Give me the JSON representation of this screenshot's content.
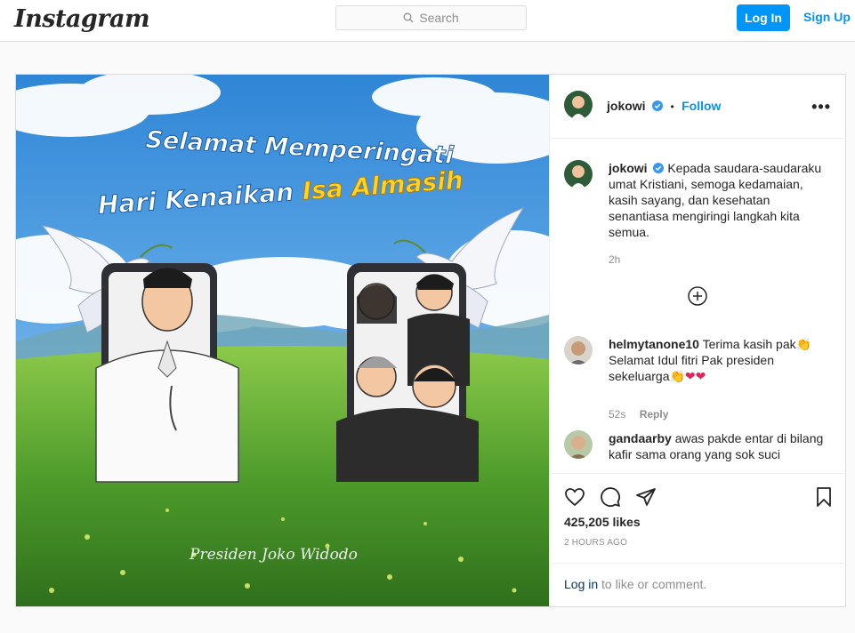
{
  "header": {
    "logo": "Instagram",
    "search_placeholder": "Search",
    "login_label": "Log In",
    "signup_label": "Sign Up"
  },
  "post": {
    "image": {
      "headline_line1": "Selamat Memperingati",
      "headline_line2_a": "Hari Kenaikan ",
      "headline_line2_b": "Isa Almasih",
      "signature": "Presiden Joko Widodo"
    },
    "author": {
      "username": "jokowi",
      "follow_label": "Follow",
      "dot": "•"
    },
    "more_icon": "•••",
    "caption": {
      "username": "jokowi",
      "text": "Kepada saudara-saudaraku umat Kristiani, semoga kedamaian, kasih sayang, dan kesehatan senantiasa mengiringi langkah kita semua.",
      "time": "2h"
    },
    "comments": [
      {
        "username": "helmytanone10",
        "text": "Terima kasih pak👏 Selamat Idul fitri Pak presiden sekeluarga👏",
        "hearts": "❤❤",
        "time": "52s",
        "reply_label": "Reply"
      },
      {
        "username": "gandaarby",
        "text": "awas pakde entar di bilang kafir sama orang yang sok suci"
      }
    ],
    "likes": "425,205 likes",
    "timestamp": "2 HOURS AGO",
    "login_prompt_link": "Log in",
    "login_prompt_text": " to like or comment."
  },
  "colors": {
    "accent": "#0095f6",
    "border": "#dbdbdb",
    "heart": "#e0245e"
  }
}
